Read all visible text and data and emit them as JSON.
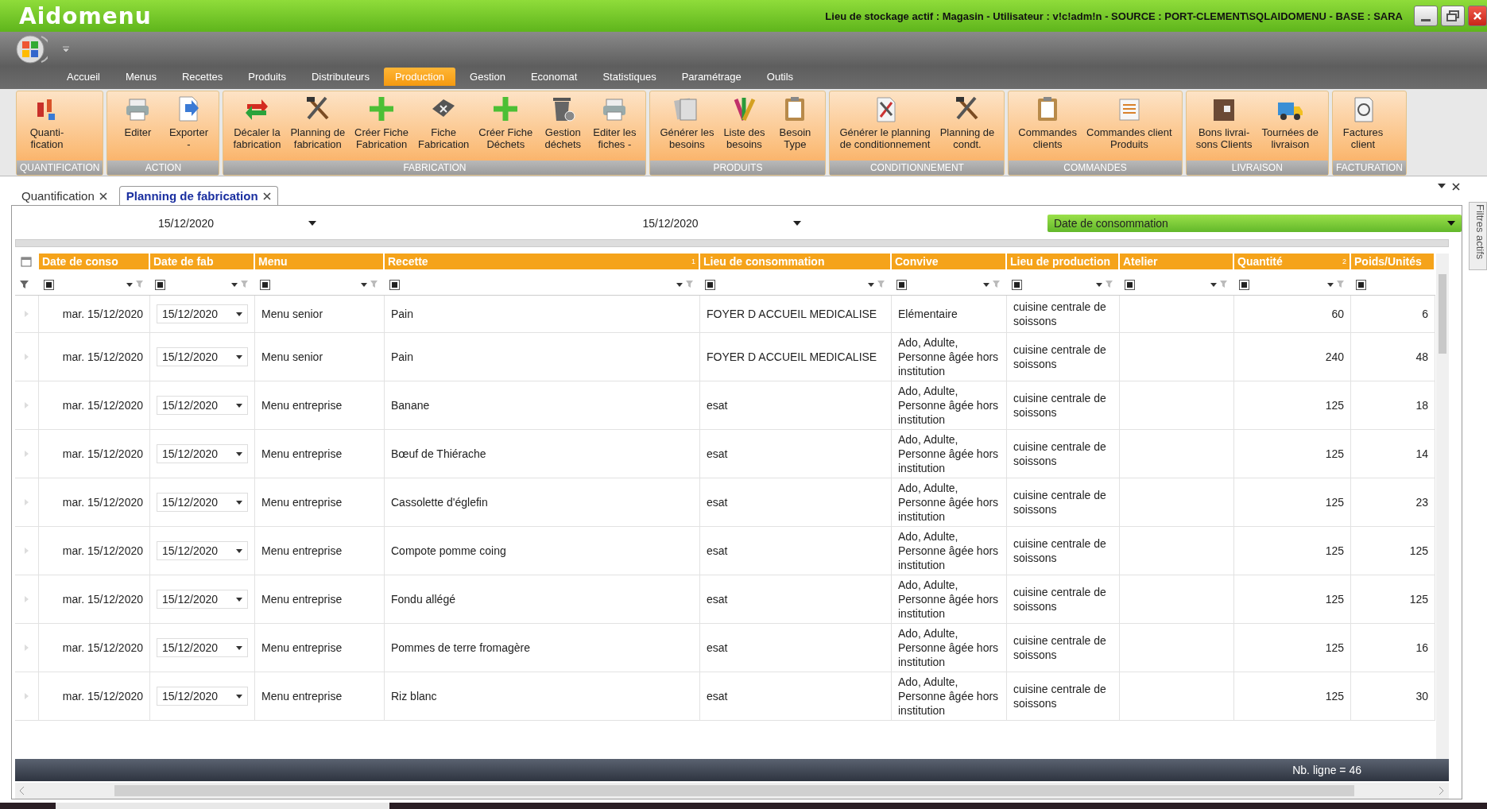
{
  "window": {
    "title": "Aidomenu",
    "info": "Lieu de stockage actif : Magasin - Utilisateur : v!c!adm!n - SOURCE : PORT-CLEMENT\\SQLAIDOMENU - BASE : SARA"
  },
  "menu": [
    {
      "label": "Accueil",
      "selected": false
    },
    {
      "label": "Menus",
      "selected": false
    },
    {
      "label": "Recettes",
      "selected": false
    },
    {
      "label": "Produits",
      "selected": false
    },
    {
      "label": "Distributeurs",
      "selected": false
    },
    {
      "label": "Production",
      "selected": true
    },
    {
      "label": "Gestion",
      "selected": false
    },
    {
      "label": "Economat",
      "selected": false
    },
    {
      "label": "Statistiques",
      "selected": false
    },
    {
      "label": "Paramétrage",
      "selected": false
    },
    {
      "label": "Outils",
      "selected": false
    }
  ],
  "ribbon": [
    {
      "label": "QUANTIFICATION",
      "buttons": [
        "Quanti-\nfication"
      ]
    },
    {
      "label": "ACTION",
      "buttons": [
        "Editer",
        "Exporter\n-"
      ]
    },
    {
      "label": "FABRICATION",
      "buttons": [
        "Décaler la\nfabrication",
        "Planning de\nfabrication",
        "Créer Fiche\nFabrication",
        "Fiche\nFabrication",
        "Créer Fiche\nDéchets",
        "Gestion\ndéchets",
        "Editer les\nfiches -"
      ]
    },
    {
      "label": "PRODUITS",
      "buttons": [
        "Générer les\nbesoins",
        "Liste des\nbesoins",
        "Besoin\nType"
      ]
    },
    {
      "label": "CONDITIONNEMENT",
      "buttons": [
        "Générer le planning\nde conditionnement",
        "Planning de\ncondt."
      ]
    },
    {
      "label": "COMMANDES",
      "buttons": [
        "Commandes\nclients",
        "Commandes client\nProduits"
      ]
    },
    {
      "label": "LIVRAISON",
      "buttons": [
        "Bons livrai-\nsons Clients",
        "Tournées de\nlivraison"
      ]
    },
    {
      "label": "FACTURATION",
      "buttons": [
        "Factures\nclient"
      ]
    }
  ],
  "doc_tabs": [
    {
      "label": "Quantification",
      "selected": false
    },
    {
      "label": "Planning de fabrication",
      "selected": true
    }
  ],
  "filters": {
    "date_from": "15/12/2020",
    "date_to": "15/12/2020",
    "date_type": "Date de consommation",
    "side_tab": "Filtres actifs"
  },
  "table": {
    "columns": [
      {
        "label": "Date de conso"
      },
      {
        "label": "Date de fab"
      },
      {
        "label": "Menu"
      },
      {
        "label": "Recette",
        "sort": "1"
      },
      {
        "label": "Lieu de consommation"
      },
      {
        "label": "Convive"
      },
      {
        "label": "Lieu de production"
      },
      {
        "label": "Atelier"
      },
      {
        "label": "Quantité",
        "sort": "2"
      },
      {
        "label": "Poids/Unités"
      }
    ],
    "rows": [
      [
        "mar. 15/12/2020",
        "15/12/2020",
        "Menu senior",
        "Pain",
        "FOYER D ACCUEIL MEDICALISE",
        "Elémentaire",
        "cuisine centrale de soissons",
        null,
        "60",
        "6"
      ],
      [
        "mar. 15/12/2020",
        "15/12/2020",
        "Menu senior",
        "Pain",
        "FOYER D ACCUEIL MEDICALISE",
        "Ado, Adulte, Personne âgée hors institution",
        "cuisine centrale de soissons",
        null,
        "240",
        "48"
      ],
      [
        "mar. 15/12/2020",
        "15/12/2020",
        "Menu entreprise",
        "Banane",
        "esat",
        "Ado, Adulte, Personne âgée hors institution",
        "cuisine centrale de soissons",
        null,
        "125",
        "18"
      ],
      [
        "mar. 15/12/2020",
        "15/12/2020",
        "Menu entreprise",
        "Bœuf de Thiérache",
        "esat",
        "Ado, Adulte, Personne âgée hors institution",
        "cuisine centrale de soissons",
        null,
        "125",
        "14"
      ],
      [
        "mar. 15/12/2020",
        "15/12/2020",
        "Menu entreprise",
        "Cassolette d'églefin",
        "esat",
        "Ado, Adulte, Personne âgée hors institution",
        "cuisine centrale de soissons",
        null,
        "125",
        "23"
      ],
      [
        "mar. 15/12/2020",
        "15/12/2020",
        "Menu entreprise",
        "Compote pomme coing",
        "esat",
        "Ado, Adulte, Personne âgée hors institution",
        "cuisine centrale de soissons",
        null,
        "125",
        "125"
      ],
      [
        "mar. 15/12/2020",
        "15/12/2020",
        "Menu entreprise",
        "Fondu allégé",
        "esat",
        "Ado, Adulte, Personne âgée hors institution",
        "cuisine centrale de soissons",
        null,
        "125",
        "125"
      ],
      [
        "mar. 15/12/2020",
        "15/12/2020",
        "Menu entreprise",
        "Pommes de terre fromagère",
        "esat",
        "Ado, Adulte, Personne âgée hors institution",
        "cuisine centrale de soissons",
        null,
        "125",
        "16"
      ],
      [
        "mar. 15/12/2020",
        "15/12/2020",
        "Menu entreprise",
        "Riz blanc",
        "esat",
        "Ado, Adulte, Personne âgée hors institution",
        "cuisine centrale de soissons",
        null,
        "125",
        "30"
      ]
    ],
    "footer": "Nb. ligne = 46"
  }
}
